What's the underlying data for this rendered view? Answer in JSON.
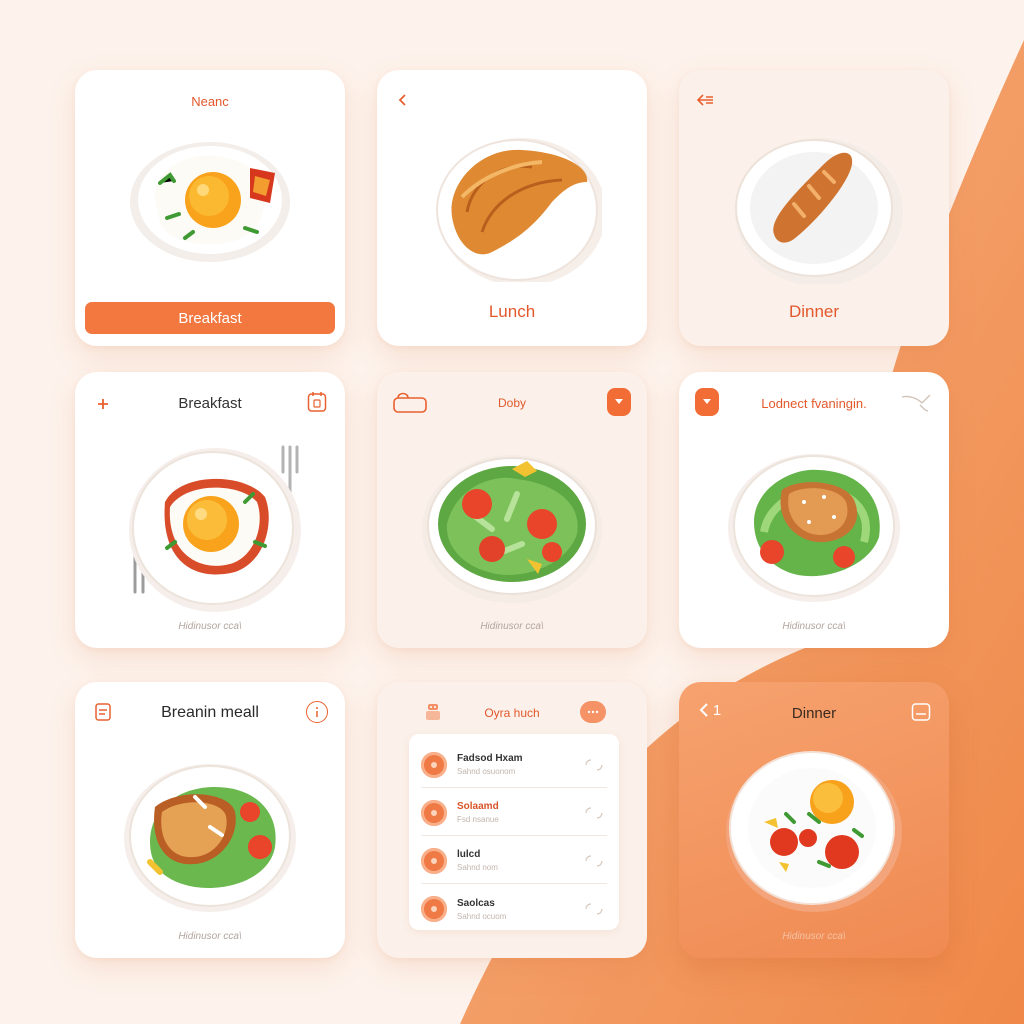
{
  "colors": {
    "accent": "#f26d36",
    "accent_light": "#f6a26f",
    "background": "#fdf3ec",
    "card": "#ffffff"
  },
  "cards": {
    "c1": {
      "header": "Neanc",
      "cta": "Breakfast",
      "header_icon": ""
    },
    "c2": {
      "back_icon": "chevron-left-icon",
      "caption": "Lunch"
    },
    "c3": {
      "back_icon": "back-arrow-icon",
      "caption": "Dinner"
    },
    "c4": {
      "left_icon": "plus-icon",
      "title": "Breakfast",
      "right_icon": "calendar-icon",
      "footnote": "Hidinusor cca\\"
    },
    "c5": {
      "left_icon": "lunchbox-icon",
      "title": "Doby",
      "right_icon": "chevron-down-icon",
      "footnote": "Hidinusor cca\\"
    },
    "c6": {
      "left_icon": "chevron-down-icon",
      "title": "Lodnect fvaningin.",
      "right_icon": "whisk-icon",
      "footnote": "Hidinusor cca\\"
    },
    "c7": {
      "left_icon": "notepad-icon",
      "title": "Breanin meall",
      "right_icon": "info-icon",
      "footnote": "Hidinusor cca\\"
    },
    "c8": {
      "left_icon": "robot-icon",
      "title": "Oyra huch",
      "right_icon": "more-icon",
      "rows": [
        {
          "title": "Fadsod Hxam",
          "sub": "Sahnd osuonom"
        },
        {
          "title": "Solaamd",
          "sub": "Fsd nsanue"
        },
        {
          "title": "lulcd",
          "sub": "Sahnd nom"
        },
        {
          "title": "Saolcas",
          "sub": "Sahnd ocuom"
        }
      ]
    },
    "c9": {
      "left_icon": "chevron-left-icon",
      "left_text": "1",
      "title": "Dinner",
      "right_icon": "tray-icon",
      "footnote": "Hidinusor cca\\"
    }
  }
}
